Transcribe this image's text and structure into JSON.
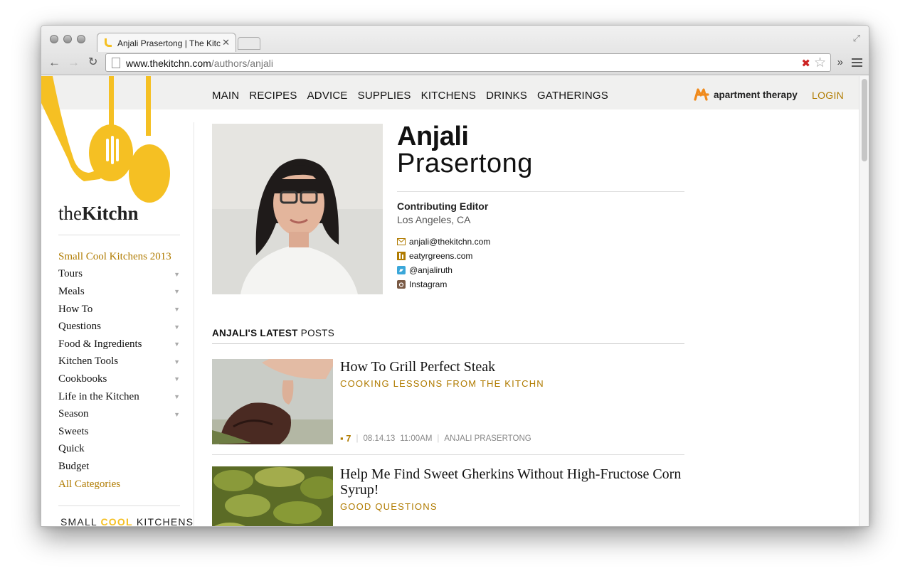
{
  "browser": {
    "tab_title": "Anjali Prasertong | The Kitc",
    "url_host": "www.thekitchn.com",
    "url_path": "/authors/anjali"
  },
  "site": {
    "nav": [
      "MAIN",
      "RECIPES",
      "ADVICE",
      "SUPPLIES",
      "KITCHENS",
      "DRINKS",
      "GATHERINGS"
    ],
    "brand": "apartment therapy",
    "login": "LOGIN",
    "name_light": "the",
    "name_bold": "Kitchn",
    "accent": "#b07b00",
    "yellow": "#f5c023"
  },
  "sidebar": {
    "featured": "Small Cool Kitchens 2013",
    "items": [
      {
        "label": "Tours",
        "arrow": true
      },
      {
        "label": "Meals",
        "arrow": true
      },
      {
        "label": "How To",
        "arrow": true
      },
      {
        "label": "Questions",
        "arrow": true
      },
      {
        "label": "Food & Ingredients",
        "arrow": true
      },
      {
        "label": "Kitchen Tools",
        "arrow": true
      },
      {
        "label": "Cookbooks",
        "arrow": true
      },
      {
        "label": "Life in the Kitchen",
        "arrow": true
      },
      {
        "label": "Season",
        "arrow": true
      },
      {
        "label": "Sweets",
        "arrow": false
      },
      {
        "label": "Quick",
        "arrow": false
      },
      {
        "label": "Budget",
        "arrow": false
      }
    ],
    "all": "All Categories",
    "promo_a": "SMALL ",
    "promo_b": "COOL",
    "promo_c": " KITCHENS"
  },
  "author": {
    "first": "Anjali",
    "last": "Prasertong",
    "role": "Contributing Editor",
    "location": "Los Angeles, CA",
    "email": "anjali@thekitchn.com",
    "website": "eatyrgreens.com",
    "twitter": "@anjaliruth",
    "instagram": "Instagram"
  },
  "posts_heading_bold": "ANJALI'S LATEST",
  "posts_heading_rest": " POSTS",
  "posts": [
    {
      "title": "How To Grill Perfect Steak",
      "category": "COOKING LESSONS FROM THE KITCHN",
      "comments": "7",
      "date": "08.14.13",
      "time": "11:00AM",
      "author": "ANJALI PRASERTONG"
    },
    {
      "title": "Help Me Find Sweet Gherkins Without High-Fructose Corn Syrup!",
      "category": "GOOD QUESTIONS"
    }
  ]
}
